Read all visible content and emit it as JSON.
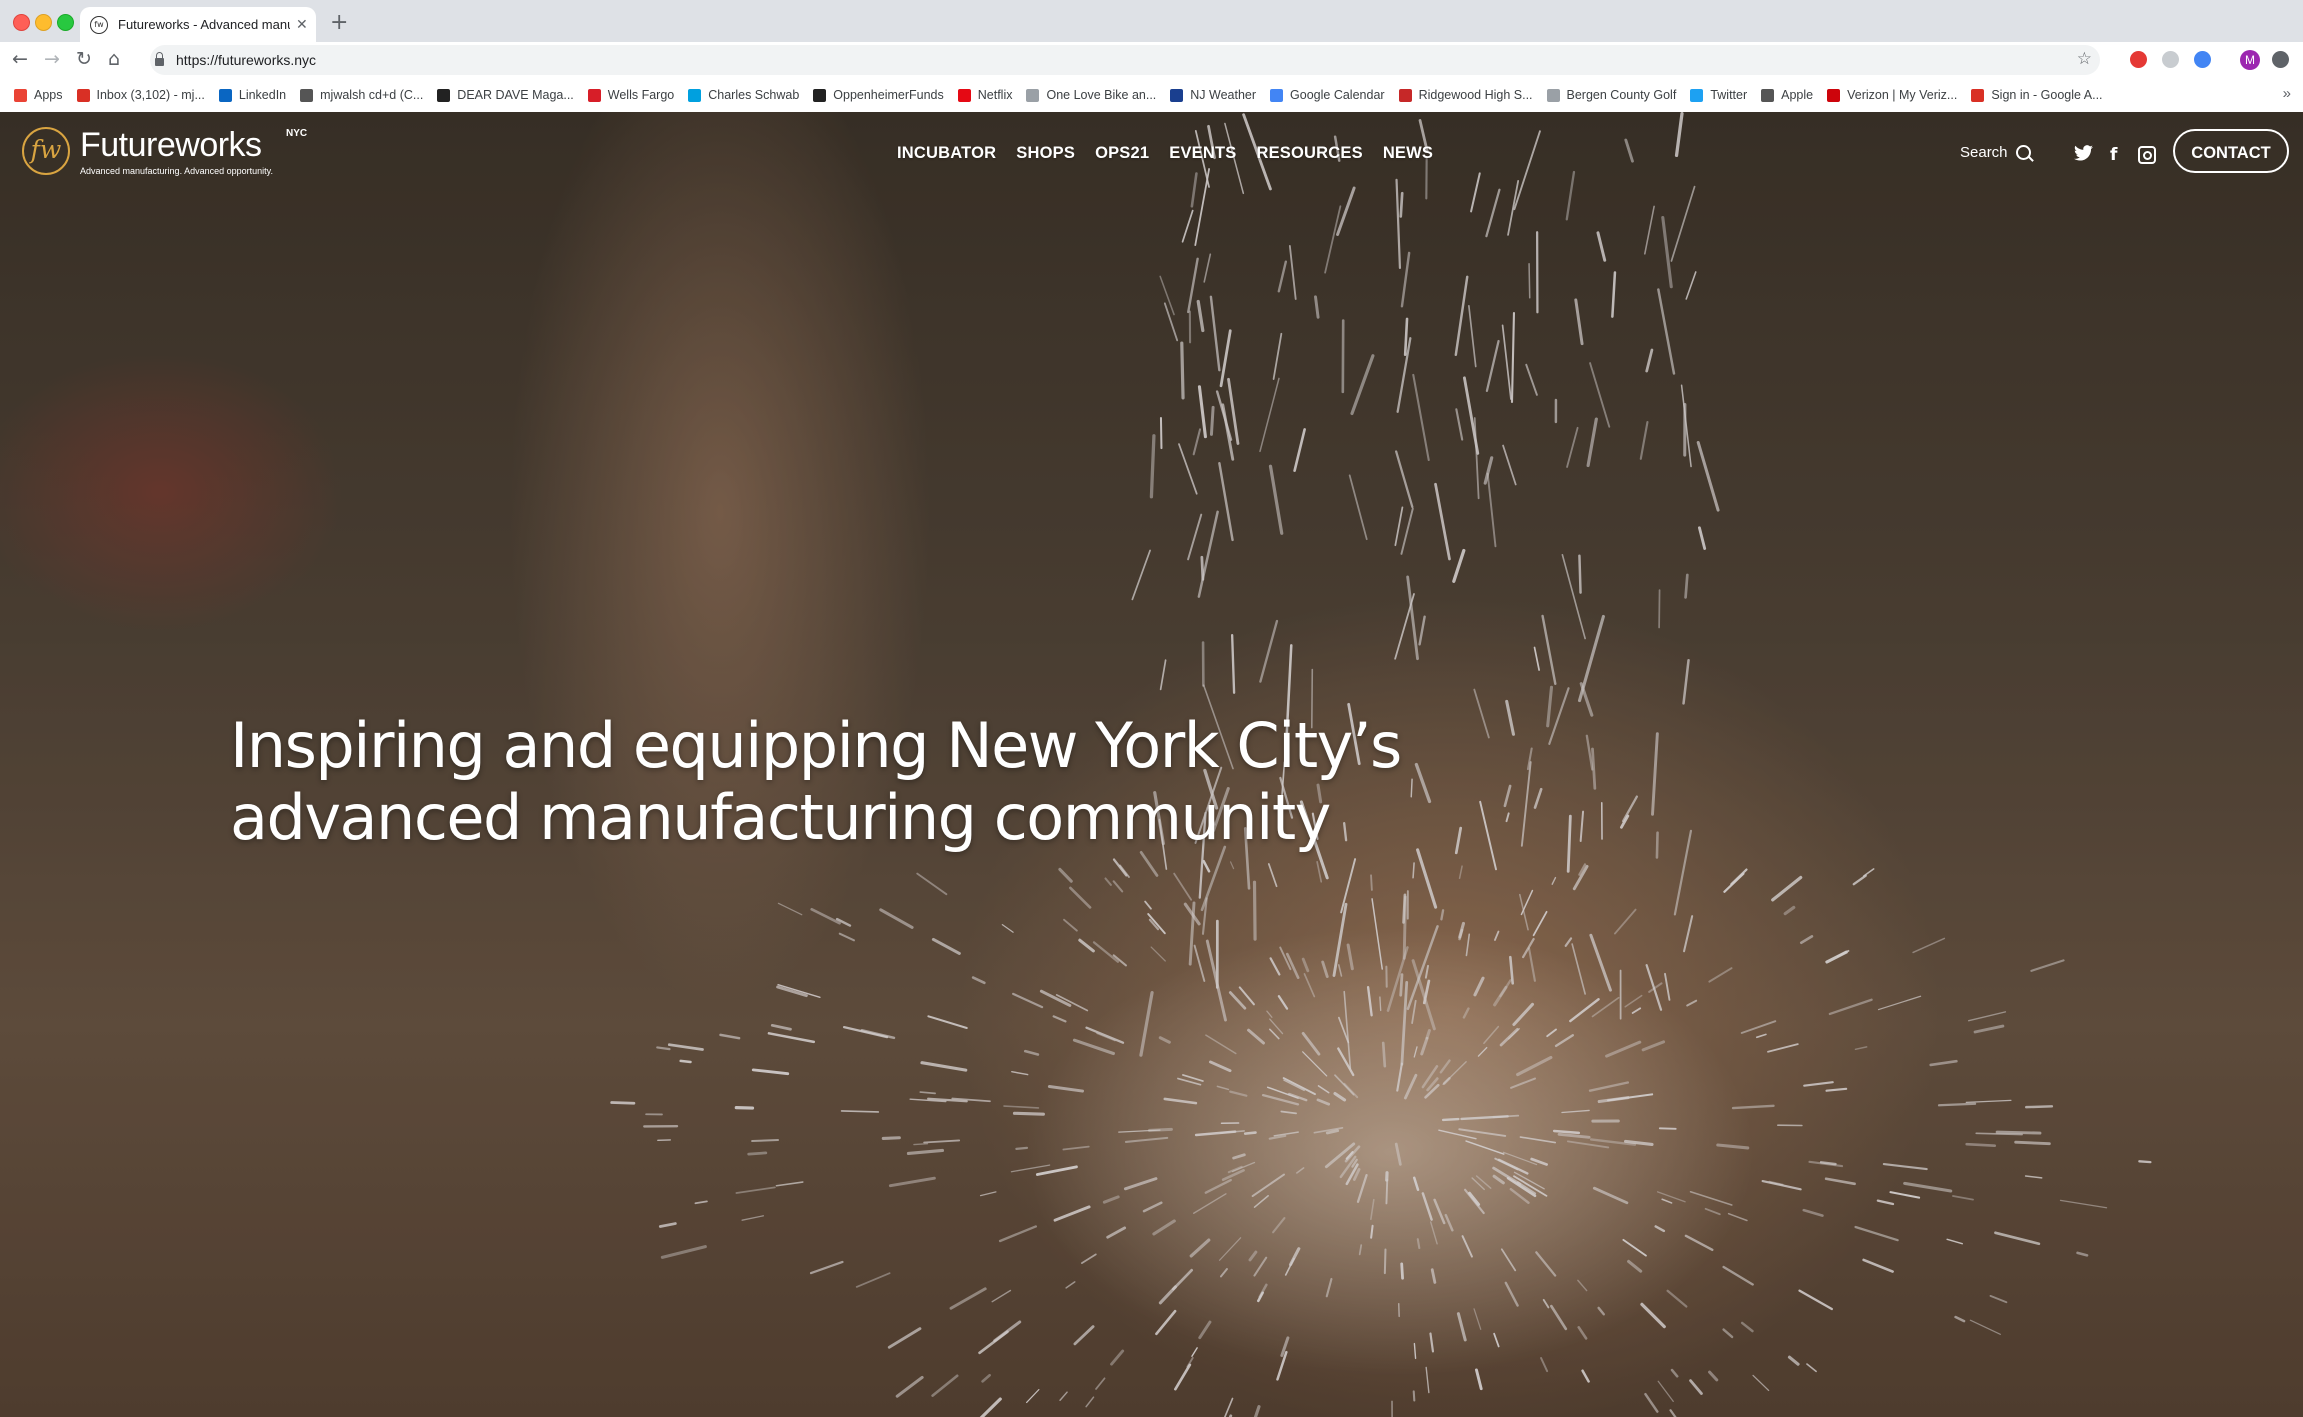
{
  "browser": {
    "tab_title": "Futureworks - Advanced manu",
    "tab_favicon_text": "fw",
    "url": "https://futureworks.nyc",
    "avatar_letter": "M",
    "bookmarks": [
      {
        "label": "Apps",
        "icon": "apps-grid-icon",
        "color": "#ea4335"
      },
      {
        "label": "Inbox (3,102) - mj...",
        "icon": "gmail-icon",
        "color": "#d93025"
      },
      {
        "label": "LinkedIn",
        "icon": "linkedin-icon",
        "color": "#0a66c2"
      },
      {
        "label": "mjwalsh cd+d (C...",
        "icon": "cdd-icon",
        "color": "#555555"
      },
      {
        "label": "DEAR DAVE Maga...",
        "icon": "feather-icon",
        "color": "#222222"
      },
      {
        "label": "Wells Fargo",
        "icon": "wells-fargo-icon",
        "color": "#d71e28"
      },
      {
        "label": "Charles Schwab",
        "icon": "schwab-icon",
        "color": "#00a0df"
      },
      {
        "label": "OppenheimerFunds",
        "icon": "oppenheimer-icon",
        "color": "#222222"
      },
      {
        "label": "Netflix",
        "icon": "netflix-icon",
        "color": "#e50914"
      },
      {
        "label": "One Love Bike an...",
        "icon": "page-icon",
        "color": "#9aa0a6"
      },
      {
        "label": "NJ Weather",
        "icon": "weather-icon",
        "color": "#1a3f8f"
      },
      {
        "label": "Google Calendar",
        "icon": "calendar-icon",
        "color": "#4285f4"
      },
      {
        "label": "Ridgewood High S...",
        "icon": "ridgewood-icon",
        "color": "#c62828"
      },
      {
        "label": "Bergen County Golf",
        "icon": "page-icon",
        "color": "#9aa0a6"
      },
      {
        "label": "Twitter",
        "icon": "twitter-icon",
        "color": "#1da1f2"
      },
      {
        "label": "Apple",
        "icon": "apple-icon",
        "color": "#555555"
      },
      {
        "label": "Verizon | My Veriz...",
        "icon": "verizon-icon",
        "color": "#cd040b"
      },
      {
        "label": "Sign in - Google A...",
        "icon": "gmail-icon",
        "color": "#d93025"
      }
    ],
    "bookmarks_more": "»"
  },
  "site": {
    "logo_mark": "fw",
    "logo_word": "Futureworks",
    "logo_nyc": "NYC",
    "logo_tagline": "Advanced manufacturing. Advanced opportunity.",
    "brand_color": "#d9a441",
    "nav": [
      "INCUBATOR",
      "SHOPS",
      "OPS21",
      "EVENTS",
      "RESOURCES",
      "NEWS"
    ],
    "search_label": "Search",
    "social": [
      "twitter-icon",
      "facebook-icon",
      "instagram-icon"
    ],
    "contact_label": "CONTACT",
    "headline_line1": "Inspiring and equipping New York City’s",
    "headline_line2": "advanced manufacturing community"
  }
}
